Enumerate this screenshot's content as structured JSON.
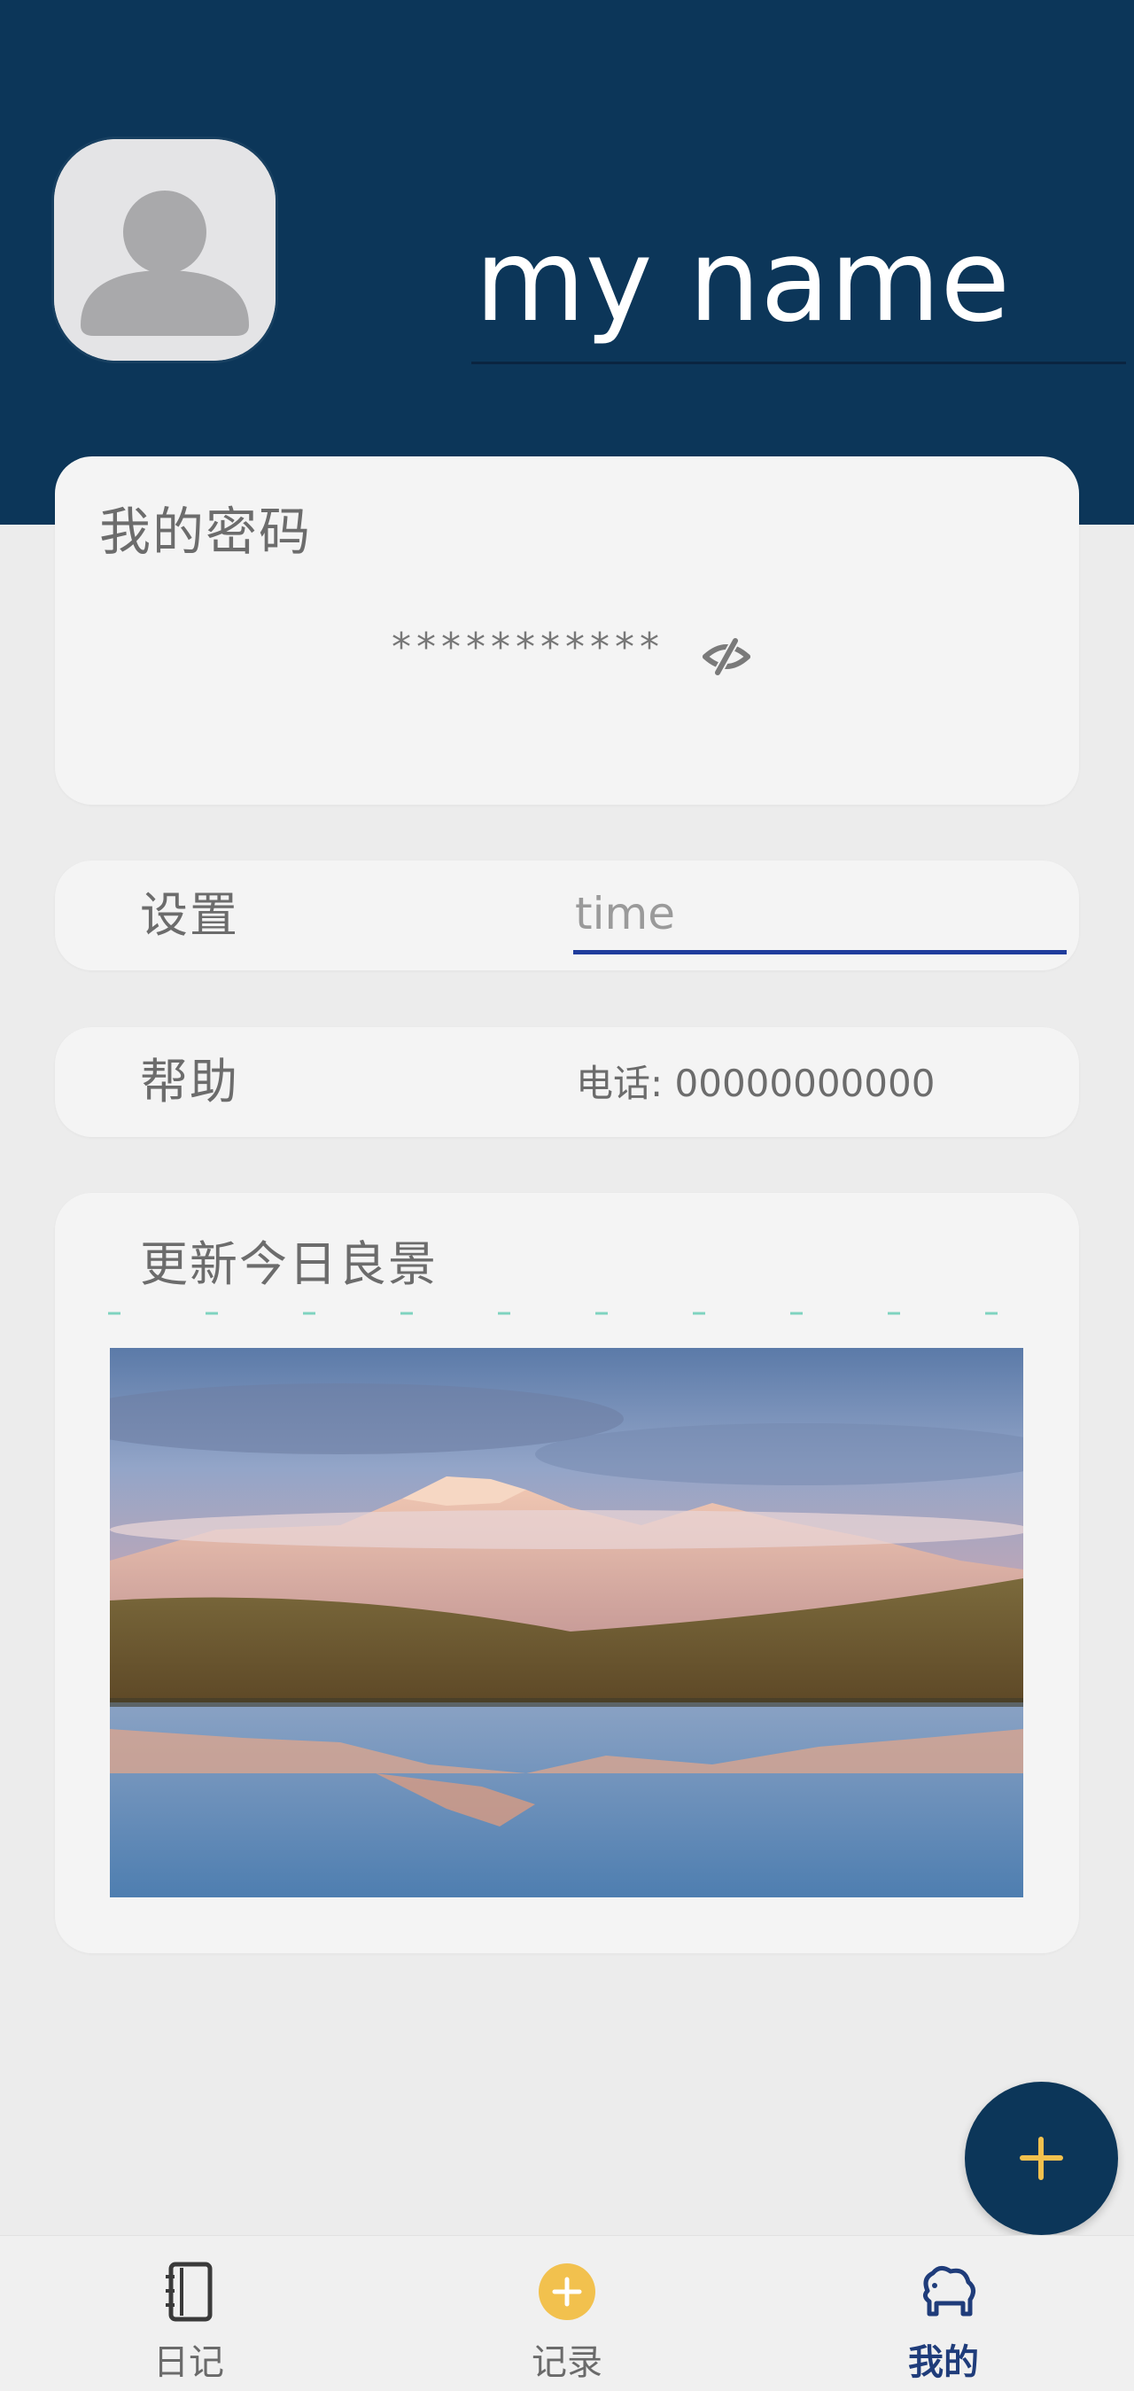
{
  "profile": {
    "username": "my name",
    "avatar_icon": "user-silhouette-icon"
  },
  "password_card": {
    "title": "我的密码",
    "masked_value": "***********",
    "toggle_icon": "eye-off-icon"
  },
  "settings_row": {
    "label": "设置",
    "input_placeholder": "time",
    "input_value": ""
  },
  "help_row": {
    "label": "帮助",
    "phone": "电话: 00000000000"
  },
  "photo_card": {
    "title": "更新今日良景",
    "image_description_icon": "mountain-lake-photo"
  },
  "fab": {
    "icon": "plus-icon"
  },
  "tabbar": {
    "items": [
      {
        "label": "日记",
        "icon": "notebook-icon",
        "active": false
      },
      {
        "label": "记录",
        "icon": "plus-circle-icon",
        "active": false
      },
      {
        "label": "我的",
        "icon": "sheep-icon",
        "active": true
      }
    ]
  },
  "colors": {
    "header_bg": "#0c3659",
    "page_bg": "#ececec",
    "card_bg": "#f4f4f4",
    "accent_blue": "#1f3c9c",
    "fab_plus": "#f2c14e",
    "tab_active": "#1f3c7a"
  }
}
